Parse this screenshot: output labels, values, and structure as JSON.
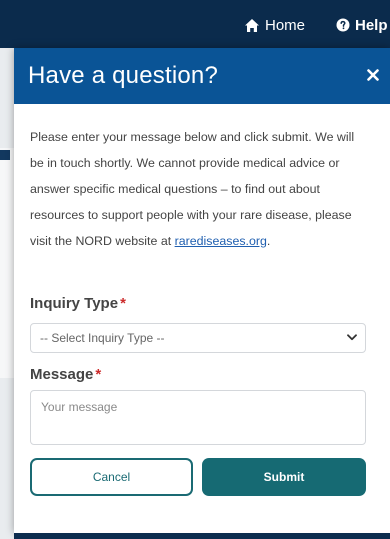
{
  "nav": {
    "home_label": "Home",
    "help_label": "Help"
  },
  "modal": {
    "title": "Have a question?",
    "intro_text": "Please enter your message below and click submit. We will be in touch shortly. We cannot provide medical advice or answer specific medical questions – to find out about resources to support people with your rare disease, please visit the NORD website at ",
    "intro_link": "rarediseases.org",
    "intro_end": ".",
    "inquiry_label": "Inquiry Type",
    "inquiry_selected": "-- Select Inquiry Type --",
    "message_label": "Message",
    "message_placeholder": "Your message",
    "required_mark": "*",
    "cancel_label": "Cancel",
    "submit_label": "Submit"
  },
  "colors": {
    "header": "#0a5496",
    "nav": "#0b2b4c",
    "accent": "#166a73",
    "required": "#cc2b2b",
    "link": "#1f5fb0"
  },
  "icons": {
    "home": "home-icon",
    "help": "question-circle-icon",
    "close": "close-icon",
    "select": "chevron-down-icon"
  }
}
